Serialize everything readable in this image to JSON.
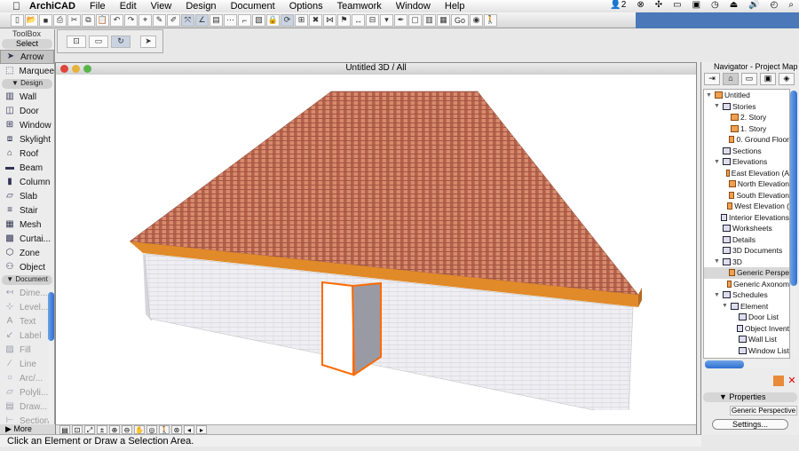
{
  "menubar": {
    "app": "ArchiCAD",
    "items": [
      "File",
      "Edit",
      "View",
      "Design",
      "Document",
      "Options",
      "Teamwork",
      "Window",
      "Help"
    ],
    "badge": "2"
  },
  "toolbox": {
    "title": "ToolBox",
    "select_header": "Select",
    "select_items": [
      "Arrow",
      "Marquee"
    ],
    "design_header": "Design",
    "design_items": [
      "Wall",
      "Door",
      "Window",
      "Skylight",
      "Roof",
      "Beam",
      "Column",
      "Slab",
      "Stair",
      "Mesh",
      "Curtai...",
      "Zone",
      "Object"
    ],
    "document_header": "Document",
    "document_items": [
      "Dime...",
      "Level...",
      "Text",
      "Label",
      "Fill",
      "Line",
      "Arc/...",
      "Polyli...",
      "Draw...",
      "Section"
    ],
    "more": "More"
  },
  "window3d": {
    "title": "Untitled 3D / All"
  },
  "status": "Click an Element or Draw a Selection Area.",
  "toolbar": {
    "go": "Go"
  },
  "navigator": {
    "title": "Navigator - Project Map",
    "tree": [
      {
        "label": "Untitled",
        "level": 0,
        "tw": "▼",
        "icon": "fi"
      },
      {
        "label": "Stories",
        "level": 1,
        "tw": "▼",
        "icon": "vi"
      },
      {
        "label": "2. Story",
        "level": 2,
        "icon": "fi"
      },
      {
        "label": "1. Story",
        "level": 2,
        "icon": "fi"
      },
      {
        "label": "0. Ground Floor",
        "level": 2,
        "icon": "fi"
      },
      {
        "label": "Sections",
        "level": 1,
        "icon": "vi"
      },
      {
        "label": "Elevations",
        "level": 1,
        "tw": "▼",
        "icon": "vi"
      },
      {
        "label": "East Elevation (A",
        "level": 2,
        "icon": "fi"
      },
      {
        "label": "North Elevation",
        "level": 2,
        "icon": "fi"
      },
      {
        "label": "South Elevation",
        "level": 2,
        "icon": "fi"
      },
      {
        "label": "West Elevation (",
        "level": 2,
        "icon": "fi"
      },
      {
        "label": "Interior Elevations",
        "level": 1,
        "icon": "vi"
      },
      {
        "label": "Worksheets",
        "level": 1,
        "icon": "vi"
      },
      {
        "label": "Details",
        "level": 1,
        "icon": "vi"
      },
      {
        "label": "3D Documents",
        "level": 1,
        "icon": "vi"
      },
      {
        "label": "3D",
        "level": 1,
        "tw": "▼",
        "icon": "vi"
      },
      {
        "label": "Generic Perspe",
        "level": 2,
        "icon": "fi",
        "selected": true
      },
      {
        "label": "Generic Axonom",
        "level": 2,
        "icon": "fi"
      },
      {
        "label": "Schedules",
        "level": 1,
        "tw": "▼",
        "icon": "vi"
      },
      {
        "label": "Element",
        "level": 2,
        "tw": "▼",
        "icon": "vi"
      },
      {
        "label": "Door List",
        "level": 3,
        "icon": "vi"
      },
      {
        "label": "Object Invent",
        "level": 3,
        "icon": "vi"
      },
      {
        "label": "Wall List",
        "level": 3,
        "icon": "vi"
      },
      {
        "label": "Window List",
        "level": 3,
        "icon": "vi"
      }
    ],
    "properties": "Properties",
    "view_name": "Generic Perspective",
    "settings": "Settings..."
  },
  "colors": {
    "roof": "#c8735a",
    "fascia": "#e08a2a",
    "wall": "#ecebf0",
    "door_outline": "#ff6a00",
    "accent": "#4a78b8"
  }
}
